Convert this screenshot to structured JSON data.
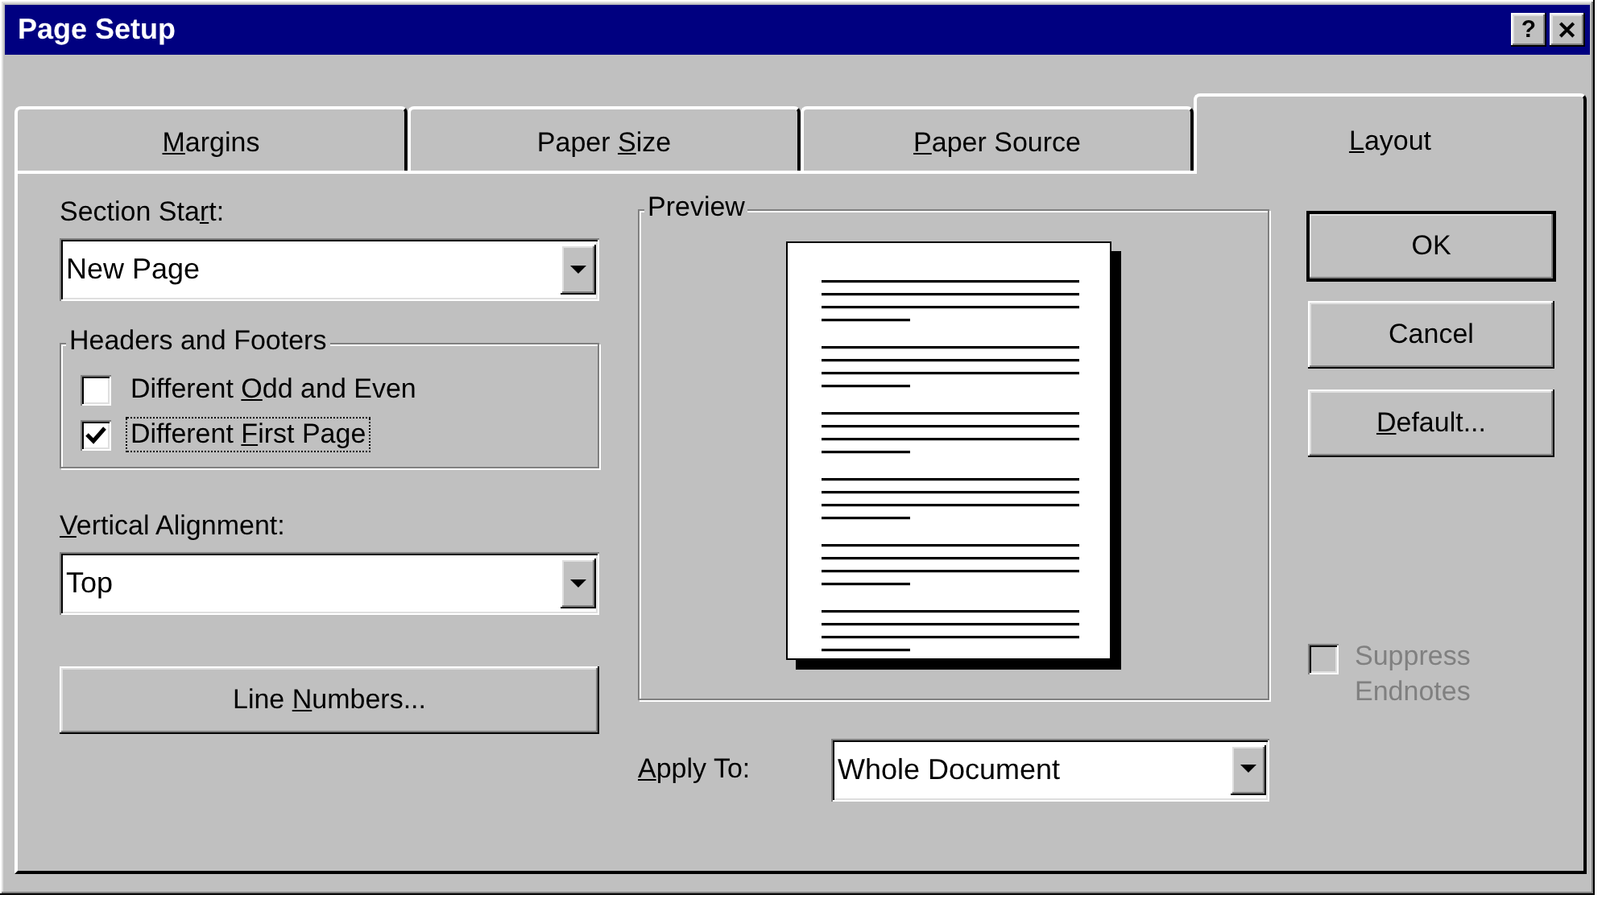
{
  "window": {
    "title": "Page Setup",
    "title_buttons": [
      "?",
      "✕"
    ]
  },
  "tabs": [
    {
      "label": {
        "key": "M",
        "post": "argins"
      },
      "selected": false
    },
    {
      "label": {
        "pre": "Paper ",
        "key": "S",
        "post": "ize"
      },
      "selected": false
    },
    {
      "label": {
        "key": "P",
        "post": "aper Source"
      },
      "selected": false
    },
    {
      "label": {
        "key": "L",
        "post": "ayout"
      },
      "selected": true
    }
  ],
  "section_start": {
    "label": {
      "pre": "Section Sta",
      "key": "r",
      "post": "t:"
    },
    "value": "New Page"
  },
  "headers_footers": {
    "title": "Headers and Footers",
    "options": [
      {
        "label": {
          "pre": "Different ",
          "key": "O",
          "post": "dd and Even"
        },
        "checked": false,
        "focused": false
      },
      {
        "label": {
          "pre": "Different ",
          "key": "F",
          "post": "irst Page"
        },
        "checked": true,
        "focused": true
      }
    ]
  },
  "vertical_alignment": {
    "label": {
      "key": "V",
      "post": "ertical Alignment:"
    },
    "value": "Top"
  },
  "line_numbers_button": {
    "label": {
      "pre": "Line ",
      "key": "N",
      "post": "umbers..."
    }
  },
  "preview": {
    "title": "Preview"
  },
  "apply_to": {
    "label": {
      "key": "A",
      "post": "pply To:"
    },
    "value": "Whole Document"
  },
  "buttons": [
    {
      "label": {
        "pre": "OK"
      },
      "default": true
    },
    {
      "label": {
        "pre": "Cancel"
      },
      "default": false
    },
    {
      "label": {
        "key": "D",
        "post": "efault..."
      },
      "default": false
    }
  ],
  "suppress_endnotes": {
    "label": "Suppress Endnotes",
    "checked": false,
    "disabled": true
  }
}
